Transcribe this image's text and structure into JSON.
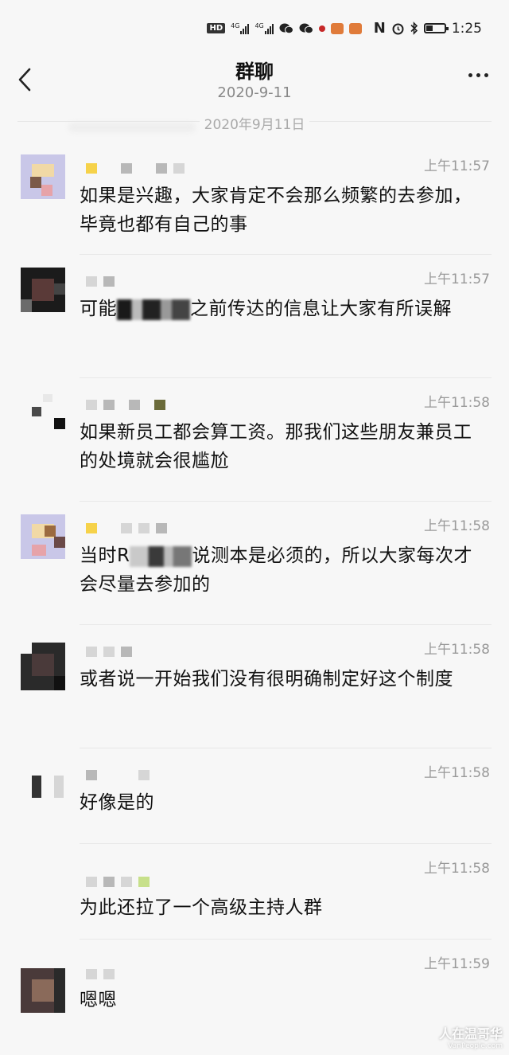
{
  "status_bar": {
    "hd": "HD",
    "net1": "4G",
    "net2": "4G",
    "nfc": "N",
    "time": "1:25"
  },
  "header": {
    "title": "群聊",
    "subtitle": "2020-9-11"
  },
  "date_divider": "2020年9月11日",
  "messages": [
    {
      "time": "上午11:57",
      "text": "如果是兴趣，大家肯定不会那么频繁的去参加，毕竟也都有自己的事"
    },
    {
      "time": "上午11:57",
      "text_before": "可能",
      "text_after": "之前传达的信息让大家有所误解"
    },
    {
      "time": "上午11:58",
      "text": "如果新员工都会算工资。那我们这些朋友兼员工的处境就会很尴尬"
    },
    {
      "time": "上午11:58",
      "text_before": "当时R",
      "text_after": "说测本是必须的，所以大家每次才会尽量去参加的"
    },
    {
      "time": "上午11:58",
      "text": "或者说一开始我们没有很明确制定好这个制度"
    },
    {
      "time": "上午11:58",
      "text": "好像是的"
    },
    {
      "time": "上午11:58",
      "text": "为此还拉了一个高级主持人群"
    },
    {
      "time": "上午11:59",
      "text": "嗯嗯"
    }
  ],
  "watermark": {
    "main": "人在温哥华",
    "sub": "VanPeople.com"
  }
}
